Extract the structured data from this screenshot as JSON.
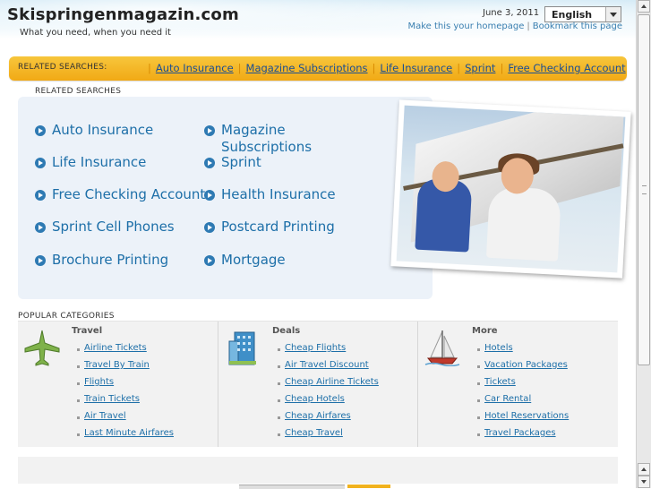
{
  "header": {
    "site_title": "Skispringenmagazin.com",
    "tagline": "What you need, when you need it",
    "date": "June 3, 2011",
    "language": "English",
    "make_homepage": "Make this your homepage",
    "bookmark": "Bookmark this page"
  },
  "bar": {
    "label": "RELATED SEARCHES:",
    "links": [
      "Auto Insurance",
      "Magazine Subscriptions",
      "Life Insurance",
      "Sprint",
      "Free Checking Account"
    ]
  },
  "related": {
    "title": "RELATED SEARCHES",
    "items": [
      "Auto Insurance",
      "Magazine Subscriptions",
      "Life Insurance",
      "Sprint",
      "Free Checking Account",
      "Health Insurance",
      "Sprint Cell Phones",
      "Postcard Printing",
      "Brochure Printing",
      "Mortgage"
    ]
  },
  "popular": {
    "title": "POPULAR CATEGORIES",
    "columns": [
      {
        "heading": "Travel",
        "icon": "airplane-icon",
        "links": [
          "Airline Tickets",
          "Travel By Train",
          "Flights",
          "Train Tickets",
          "Air Travel",
          "Last Minute Airfares"
        ]
      },
      {
        "heading": "Deals",
        "icon": "hotel-building-icon",
        "links": [
          "Cheap Flights",
          "Air Travel Discount",
          "Cheap Airline Tickets",
          "Cheap Hotels",
          "Cheap Airfares",
          "Cheap Travel"
        ]
      },
      {
        "heading": "More",
        "icon": "sailboat-icon",
        "links": [
          "Hotels",
          "Vacation Packages",
          "Tickets",
          "Car Rental",
          "Hotel Reservations",
          "Travel Packages"
        ]
      }
    ]
  },
  "colors": {
    "link": "#1d6fa8",
    "bar": "#f1a915",
    "panel": "#ecf2f9"
  }
}
